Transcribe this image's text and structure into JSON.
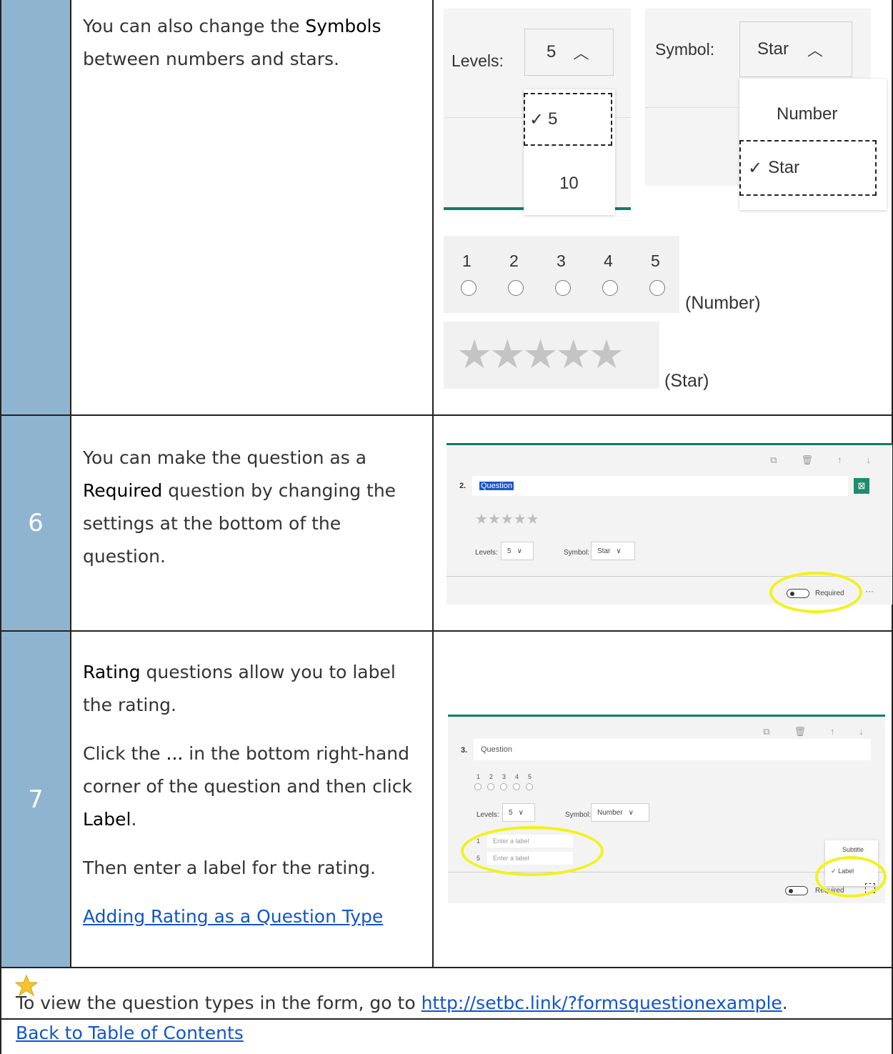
{
  "row5": {
    "number": "",
    "text_before": "You can also change the ",
    "text_bold": "Symbols",
    "text_after": " between numbers and stars.",
    "levels_label": "Levels:",
    "levels_value": "5",
    "levels_options": [
      "5",
      "10"
    ],
    "levels_selected": "5",
    "symbol_label": "Symbol:",
    "symbol_value": "Star",
    "symbol_options": [
      "Number",
      "Star"
    ],
    "symbol_selected": "Star",
    "number_scale": [
      "1",
      "2",
      "3",
      "4",
      "5"
    ],
    "number_caption": "(Number)",
    "stars_glyphs": "★★★★★",
    "star_caption": "(Star)",
    "check_mark": "✓",
    "caret_up": "︿"
  },
  "row6": {
    "number": "6",
    "text_before": "You can make the question as a ",
    "text_bold": "Required",
    "text_after": " question by changing the settings at the bottom of the question.",
    "card": {
      "question_number": "2.",
      "question_text": "Question",
      "stars": "★★★★★",
      "levels_label": "Levels:",
      "levels_value": "5",
      "symbol_label": "Symbol:",
      "symbol_value": "Star",
      "required_label": "Required",
      "more": "···",
      "image_icon": "⊠",
      "chevron": "∨",
      "tools": [
        "⧉",
        "🗑",
        "↑",
        "↓"
      ]
    }
  },
  "row7": {
    "number": "7",
    "p1_bold": "Rating",
    "p1_after": " questions allow you to label the rating.",
    "p2_before": "Click the ",
    "p2_bold1": "...",
    "p2_mid": " in the bottom right-hand corner of the question and then click ",
    "p2_bold2": "Label",
    "p2_after": ".",
    "p3": "Then enter a label for the rating.",
    "link": "Adding Rating as a Question Type",
    "card": {
      "question_number": "3.",
      "question_text": "Question",
      "scale": [
        "1",
        "2",
        "3",
        "4",
        "5"
      ],
      "levels_label": "Levels:",
      "levels_value": "5",
      "symbol_label": "Symbol:",
      "symbol_value": "Number",
      "label_rows": [
        {
          "num": "1",
          "placeholder": "Enter a label"
        },
        {
          "num": "5",
          "placeholder": "Enter a label"
        }
      ],
      "menu_items": [
        "Subtitle",
        "Label"
      ],
      "required_label": "Required",
      "chevron": "∨",
      "check": "✓",
      "tools": [
        "⧉",
        "🗑",
        "↑",
        "↓"
      ]
    }
  },
  "footer": {
    "view_text": "To view the question types in the form, go to ",
    "view_link": "http://setbc.link/?formsquestionexample",
    "view_after": ".",
    "back_link": "Back to Table of Contents"
  }
}
